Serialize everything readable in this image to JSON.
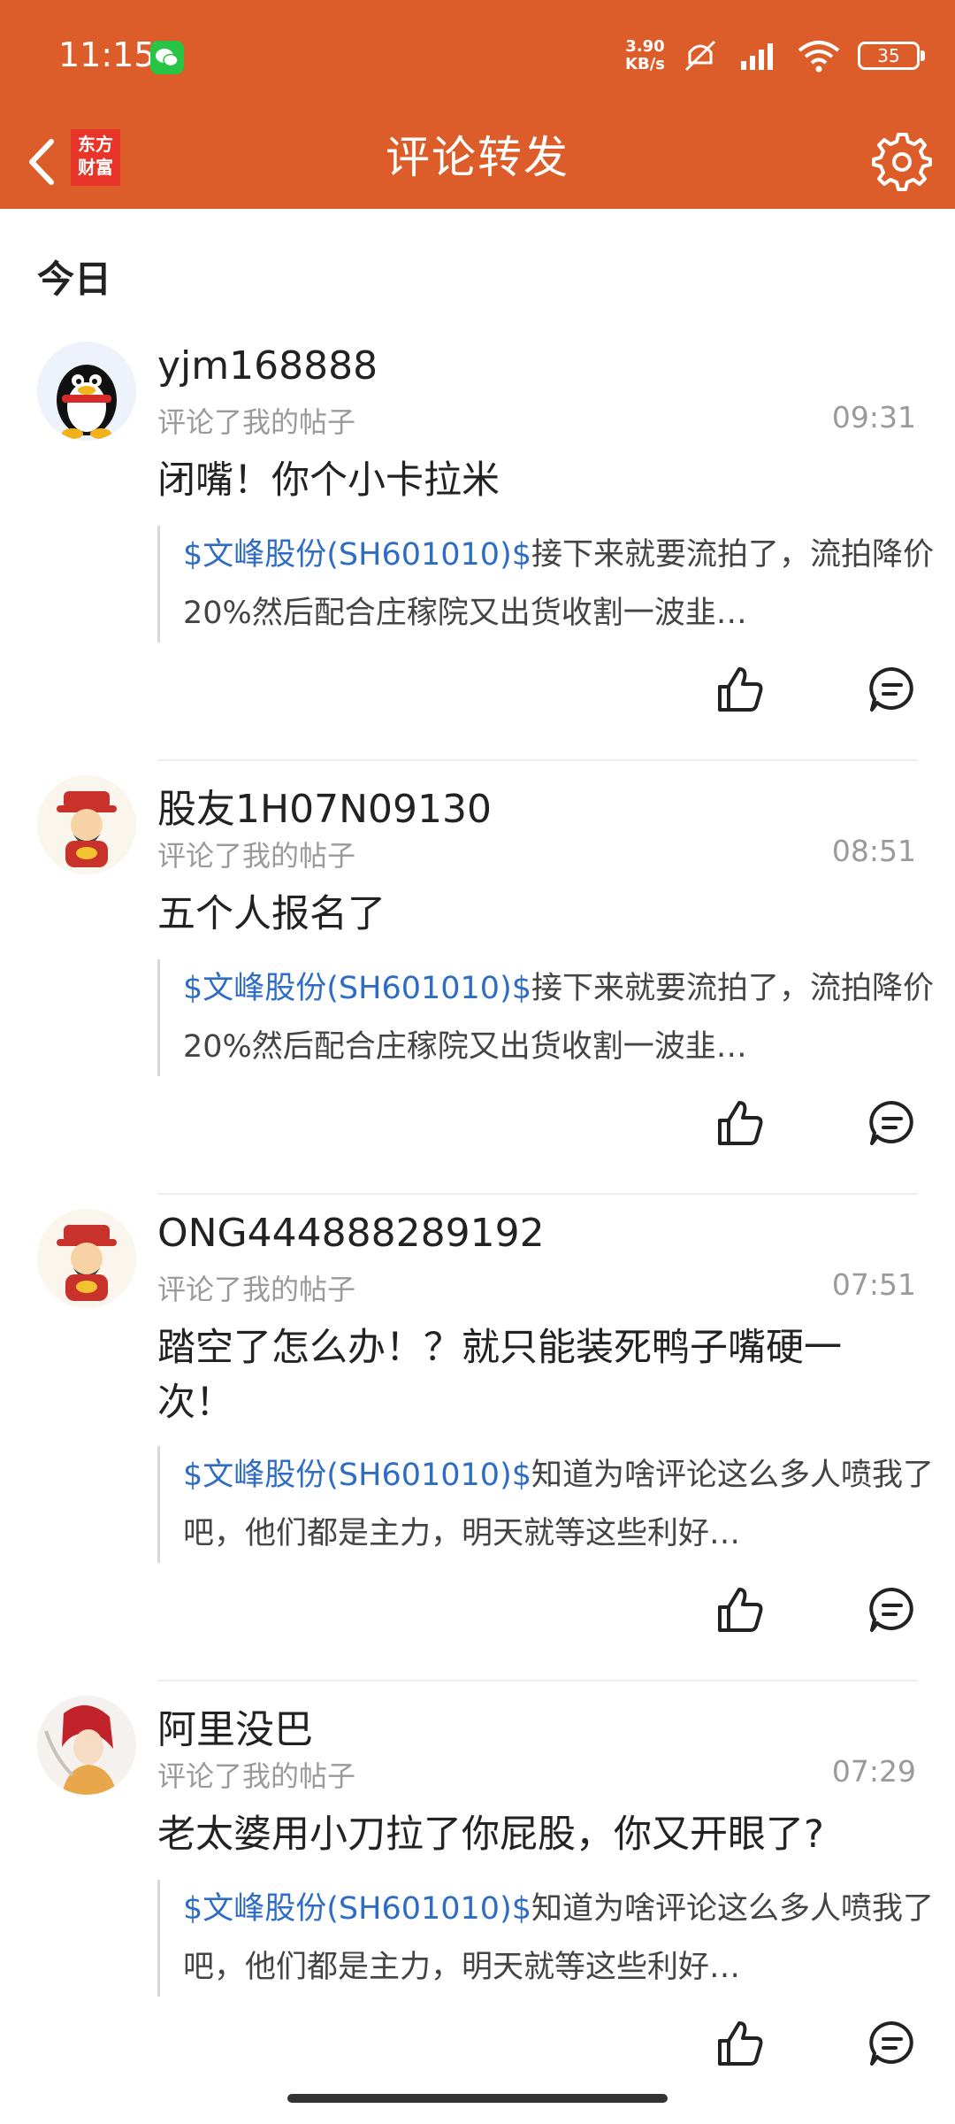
{
  "status_bar": {
    "time": "11:15",
    "net_speed_value": "3.90",
    "net_speed_unit": "KB/s",
    "battery": "35"
  },
  "nav": {
    "back_label": "back",
    "logo_line1": "东方",
    "logo_line2": "财富",
    "title": "评论转发"
  },
  "section_title": "今日",
  "items": [
    {
      "username": "yjm168888",
      "action": "评论了我的帖子",
      "time": "09:31",
      "comment": "闭嘴！你个小卡拉米",
      "quote_tag": "$文峰股份(SH601010)$",
      "quote_text": "接下来就要流拍了，流拍降价20%然后配合庄稼院又出货收割一波韭…"
    },
    {
      "username": "股友1H07N09130",
      "action": "评论了我的帖子",
      "time": "08:51",
      "comment": "五个人报名了",
      "quote_tag": "$文峰股份(SH601010)$",
      "quote_text": "接下来就要流拍了，流拍降价20%然后配合庄稼院又出货收割一波韭…"
    },
    {
      "username": "ONG444888289192",
      "action": "评论了我的帖子",
      "time": "07:51",
      "comment": "踏空了怎么办！？就只能装死鸭子嘴硬一次！",
      "quote_tag": "$文峰股份(SH601010)$",
      "quote_text": "知道为啥评论这么多人喷我了吧，他们都是主力，明天就等这些利好…"
    },
    {
      "username": "阿里没巴",
      "action": "评论了我的帖子",
      "time": "07:29",
      "comment": "老太婆用小刀拉了你屁股，你又开眼了?",
      "quote_tag": "$文峰股份(SH601010)$",
      "quote_text": "知道为啥评论这么多人喷我了吧，他们都是主力，明天就等这些利好…"
    }
  ],
  "colors": {
    "header": "#dc5d2a",
    "link": "#2f6cc4",
    "muted": "#9a9a9a"
  }
}
